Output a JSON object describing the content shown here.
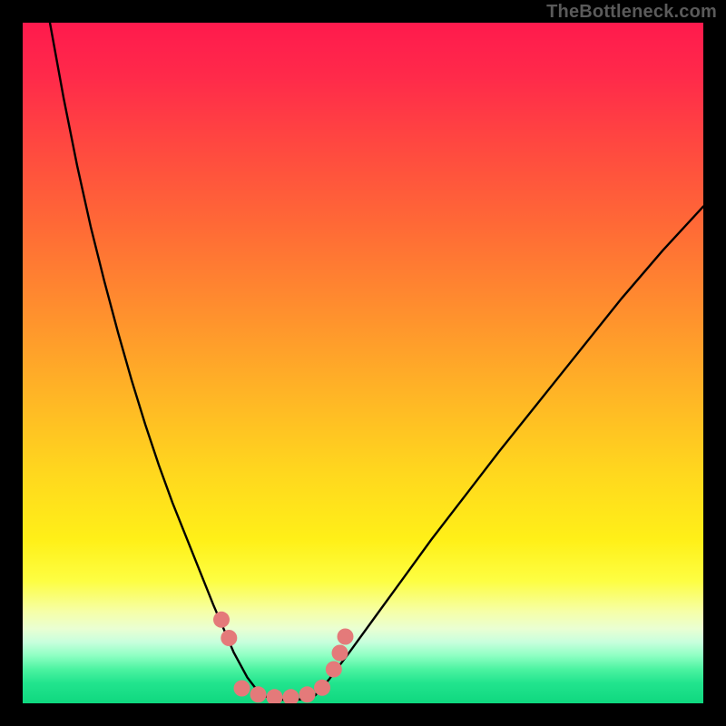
{
  "watermark": "TheBottleneck.com",
  "chart_data": {
    "type": "line",
    "title": "",
    "xlabel": "",
    "ylabel": "",
    "xlim": [
      0,
      100
    ],
    "ylim": [
      0,
      100
    ],
    "grid": false,
    "legend": false,
    "series": [
      {
        "name": "left-curve",
        "x": [
          4,
          6,
          8,
          10,
          12,
          14,
          16,
          18,
          20,
          22,
          24,
          26,
          28,
          29.5,
          31,
          33,
          35
        ],
        "y": [
          100,
          89,
          79,
          70,
          62,
          54.5,
          47.5,
          41,
          35,
          29.5,
          24.5,
          19.5,
          14.5,
          11,
          7.5,
          3.8,
          1.2
        ]
      },
      {
        "name": "valley-floor",
        "x": [
          35,
          37,
          39,
          41,
          43
        ],
        "y": [
          1.2,
          0.6,
          0.5,
          0.6,
          1.2
        ]
      },
      {
        "name": "right-curve",
        "x": [
          43,
          45,
          48,
          52,
          56,
          60,
          65,
          70,
          76,
          82,
          88,
          94,
          100
        ],
        "y": [
          1.2,
          3.5,
          7.5,
          13,
          18.5,
          24,
          30.5,
          37,
          44.5,
          52,
          59.5,
          66.5,
          73
        ]
      }
    ],
    "markers": {
      "name": "marker-dots",
      "color": "#e47a7a",
      "points": [
        {
          "x": 29.2,
          "y": 12.3
        },
        {
          "x": 30.3,
          "y": 9.6
        },
        {
          "x": 32.2,
          "y": 2.2
        },
        {
          "x": 34.6,
          "y": 1.3
        },
        {
          "x": 37.0,
          "y": 0.9
        },
        {
          "x": 39.4,
          "y": 0.9
        },
        {
          "x": 41.8,
          "y": 1.3
        },
        {
          "x": 44.0,
          "y": 2.3
        },
        {
          "x": 45.7,
          "y": 5.0
        },
        {
          "x": 46.6,
          "y": 7.4
        },
        {
          "x": 47.4,
          "y": 9.8
        }
      ]
    },
    "background_gradient": {
      "top_color": "#ff1a4d",
      "mid_color": "#fff018",
      "bottom_color": "#0fd87f"
    }
  }
}
